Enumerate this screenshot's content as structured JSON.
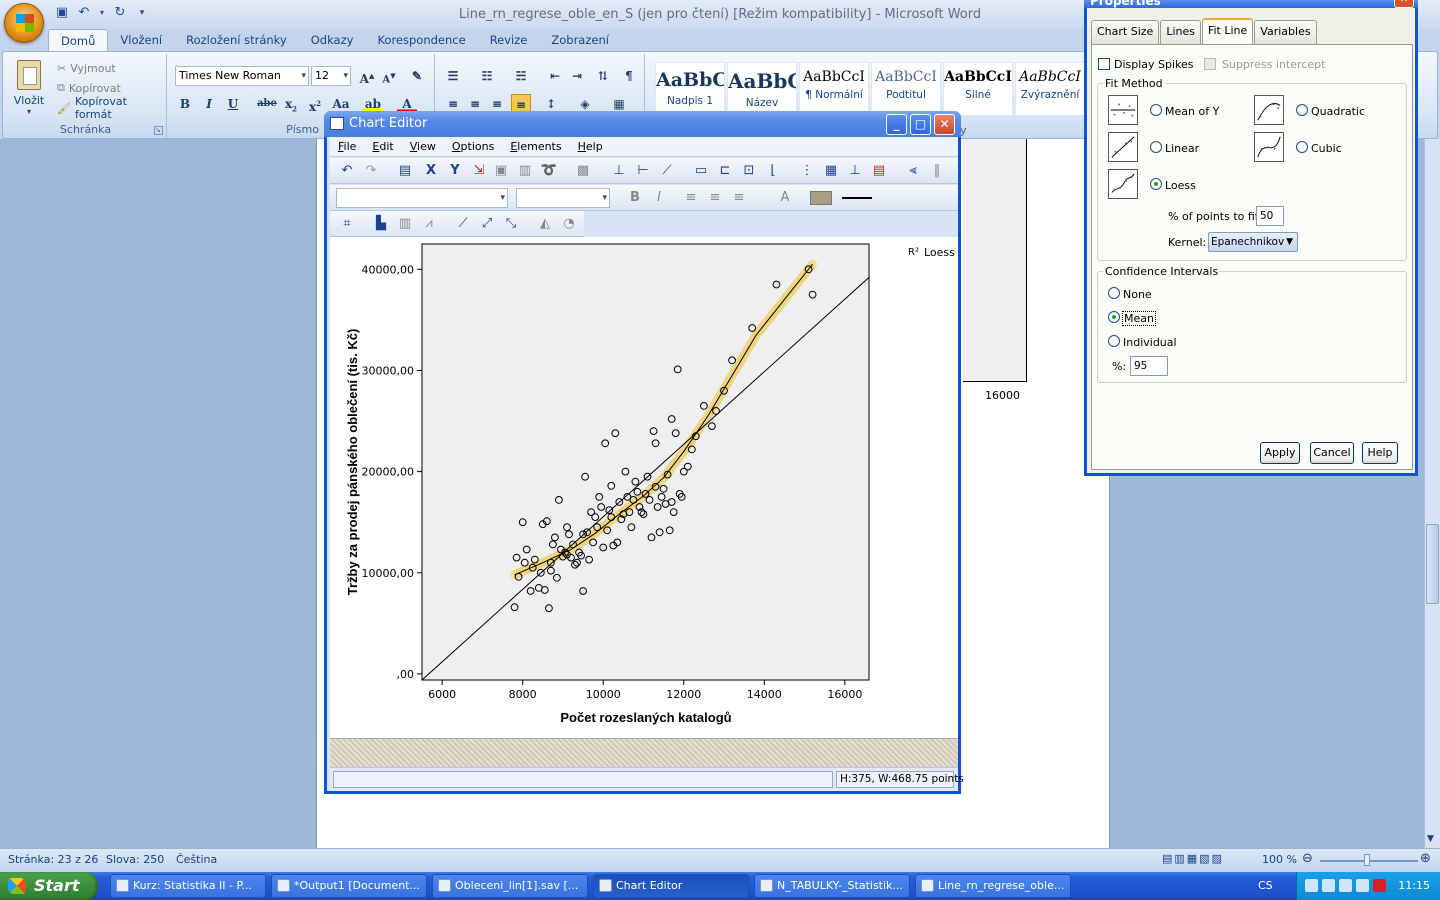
{
  "word": {
    "title": "Line_rn_regrese_oble_en_S (jen pro čtení) [Režim kompatibility] - Microsoft Word",
    "tabs": [
      "Domů",
      "Vložení",
      "Rozložení stránky",
      "Odkazy",
      "Korespondence",
      "Revize",
      "Zobrazení"
    ],
    "clipboard": {
      "paste": "Vložit",
      "cut": "Vyjmout",
      "copy": "Kopírovat",
      "format_painter": "Kopírovat formát",
      "group": "Schránka"
    },
    "font": {
      "name": "Times New Roman",
      "size": "12",
      "group": "Písmo"
    },
    "styles_group_tail": "ly",
    "styles": [
      {
        "sample": "AaBbC",
        "name": "Nadpis 1"
      },
      {
        "sample": "AaBbC",
        "name": "Název"
      },
      {
        "sample": "AaBbCcI",
        "name": "¶ Normální"
      },
      {
        "sample": "AaBbCcI",
        "name": "Podtitul"
      },
      {
        "sample": "AaBbCcI",
        "name": "Silné"
      },
      {
        "sample": "AaBbCcI",
        "name": "Zvýraznění"
      }
    ],
    "bg_chart_tick": "16000",
    "status": {
      "page": "Stránka: 23 z 26",
      "words": "Slova: 250",
      "lang": "Čeština",
      "zoom": "100 %"
    }
  },
  "chart_editor": {
    "title": "Chart Editor",
    "menu": [
      "File",
      "Edit",
      "View",
      "Options",
      "Elements",
      "Help"
    ],
    "status_right": "H:375, W:468.75 points",
    "legend_label": "Loess",
    "legend_icon_text": "R²",
    "ylabel": "Tržby za prodej pánského oblečení (tis. Kč)",
    "xlabel": "Počet rozeslaných katalogů"
  },
  "chart_data": {
    "type": "scatter",
    "xlabel": "Počet rozeslaných katalogů",
    "ylabel": "Tržby za prodej pánského oblečení (tis. Kč)",
    "xlim": [
      5500,
      16600
    ],
    "ylim": [
      -600,
      42500
    ],
    "x_ticks": [
      "6000",
      "8000",
      "10000",
      "12000",
      "14000",
      "16000"
    ],
    "x_tick_values": [
      6000,
      8000,
      10000,
      12000,
      14000,
      16000
    ],
    "y_ticks": [
      ",00",
      "10000,00",
      "20000,00",
      "30000,00",
      "40000,00"
    ],
    "y_tick_values": [
      0,
      10000,
      20000,
      30000,
      40000
    ],
    "linear_fit": {
      "x": [
        5500,
        16600
      ],
      "y": [
        -600,
        39200
      ]
    },
    "loess": {
      "x": [
        7800,
        8500,
        9200,
        9800,
        10400,
        11000,
        11500,
        12000,
        12600,
        13200,
        13800,
        14500,
        15200
      ],
      "y": [
        9800,
        11000,
        12300,
        13900,
        15800,
        17600,
        19400,
        22000,
        25500,
        29500,
        33500,
        37000,
        40500
      ]
    },
    "points": {
      "x": [
        7800,
        7850,
        7900,
        8000,
        8050,
        8100,
        8200,
        8250,
        8300,
        8400,
        8450,
        8500,
        8550,
        8600,
        8650,
        8700,
        8750,
        8800,
        8850,
        8900,
        8950,
        9000,
        9050,
        9100,
        9150,
        9200,
        9250,
        9300,
        9350,
        9400,
        9450,
        9500,
        9550,
        9600,
        9650,
        9700,
        9750,
        9800,
        9850,
        9900,
        9950,
        10000,
        10050,
        10100,
        10150,
        10200,
        10250,
        10300,
        10350,
        10400,
        10450,
        10500,
        10550,
        10600,
        10650,
        10700,
        10750,
        10800,
        10850,
        10900,
        10950,
        11000,
        11050,
        11100,
        11150,
        11200,
        11250,
        11300,
        11350,
        11400,
        11450,
        11500,
        11550,
        11600,
        11650,
        11700,
        11750,
        11800,
        11850,
        11900,
        11950,
        12000,
        12100,
        12300,
        12500,
        12700,
        12800,
        13000,
        13200,
        13700,
        14300,
        15200,
        15100,
        8700,
        9100,
        9500,
        10200,
        11300,
        11700,
        12200
      ],
      "y": [
        6600,
        11500,
        9600,
        15000,
        11000,
        12300,
        8200,
        10500,
        11300,
        8500,
        10000,
        14800,
        8300,
        15100,
        6500,
        11000,
        12800,
        13500,
        9500,
        17200,
        12300,
        11600,
        12000,
        14500,
        13800,
        11500,
        12800,
        10800,
        11000,
        12000,
        11700,
        8200,
        19500,
        14000,
        11300,
        16000,
        13000,
        15500,
        14500,
        17500,
        16500,
        12500,
        22800,
        14200,
        16200,
        15500,
        12700,
        23800,
        13000,
        17000,
        15300,
        15800,
        20000,
        17500,
        16000,
        14500,
        17200,
        19000,
        18000,
        16500,
        16000,
        15800,
        17800,
        19500,
        17200,
        13500,
        24000,
        18500,
        16500,
        14000,
        17500,
        18300,
        16800,
        19700,
        14200,
        17000,
        16000,
        23800,
        30100,
        17800,
        17500,
        20000,
        20500,
        23500,
        26500,
        24500,
        26000,
        28000,
        31000,
        34200,
        38500,
        37500,
        40000,
        10200,
        11800,
        13800,
        18600,
        22800,
        25200,
        22200
      ]
    }
  },
  "properties": {
    "title": "Properties",
    "close": "✕",
    "tabs": [
      "Chart Size",
      "Lines",
      "Fit Line",
      "Variables"
    ],
    "display_spikes": "Display Spikes",
    "suppress_intercept": "Suppress intercept",
    "fit_method_legend": "Fit Method",
    "methods": [
      "Mean of Y",
      "Quadratic",
      "Linear",
      "Cubic",
      "Loess"
    ],
    "selected_method": "Loess",
    "pct_label": "% of points to fit:",
    "pct_value": "50",
    "kernel_label": "Kernel:",
    "kernel_value": "Epanechnikov",
    "ci_legend": "Confidence Intervals",
    "ci_options": [
      "None",
      "Mean",
      "Individual"
    ],
    "selected_ci": "Mean",
    "ci_pct_label": "%:",
    "ci_pct_value": "95",
    "buttons": [
      "Apply",
      "Cancel",
      "Help"
    ]
  },
  "taskbar": {
    "start": "Start",
    "tasks": [
      "Kurz: Statistika II - P...",
      "*Output1 [Document...",
      "Obleceni_lin[1].sav [...",
      "Chart Editor",
      "N_TABULKY-_Statistik...",
      "Line_rn_regrese_oble..."
    ],
    "lang": "CS",
    "clock": "11:15"
  },
  "colors": {
    "xp_blue": "#0a54d8",
    "loess_band": "#f6dc8c",
    "plot_bg": "#efefef"
  }
}
